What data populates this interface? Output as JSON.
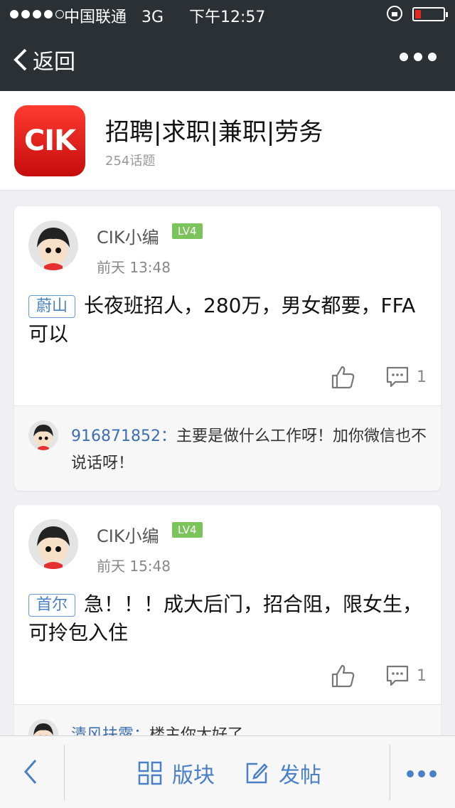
{
  "status_bar": {
    "carrier": "中国联通",
    "network": "3G",
    "time": "下午12:57",
    "battery_color": "#e5261e"
  },
  "nav": {
    "back_label": "返回",
    "more_icon": "more-dots-icon"
  },
  "forum": {
    "logo_text": "CIK",
    "title": "招聘|求职|兼职|劳务",
    "topic_count": "254话题"
  },
  "posts": [
    {
      "author": "CIK小编",
      "level": "LV4",
      "time": "前天 13:48",
      "tag": "蔚山",
      "text": "长夜班招人，280万，男女都要，FFA可以",
      "comment_count": "1",
      "reply": {
        "user": "916871852：",
        "text": "主要是做什么工作呀！加你微信也不说话呀！"
      }
    },
    {
      "author": "CIK小编",
      "level": "LV4",
      "time": "前天 15:48",
      "tag": "首尔",
      "text": "急！！！成大后门，招合阻，限女生，可拎包入住",
      "comment_count": "1",
      "reply": {
        "user": "清风扶露：",
        "text": "楼主你太好了"
      }
    }
  ],
  "bottom_bar": {
    "section_label": "版块",
    "post_label": "发帖",
    "accent": "#4a80c8"
  }
}
